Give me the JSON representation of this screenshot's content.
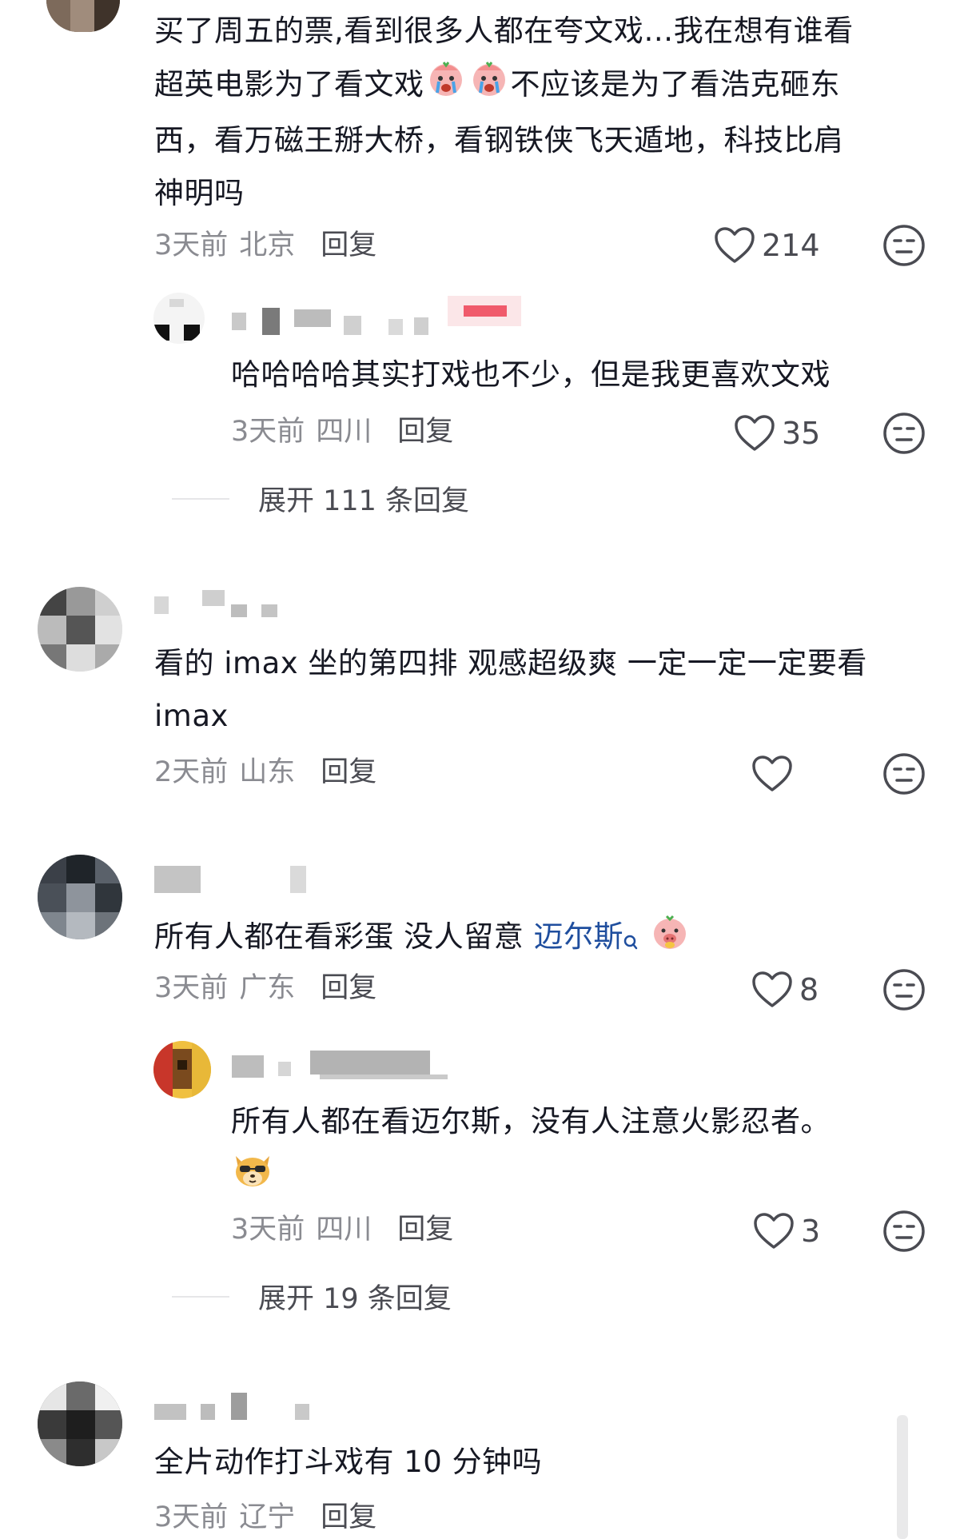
{
  "comments": [
    {
      "text_lines": [
        "买了周五的票,看到很多人都在夸文戏…我在想有谁看",
        "超英电影为了看文戏",
        "不应该是为了看浩克砸东",
        "西，看万磁王掰大桥，看钢铁侠飞天遁地，科技比肩",
        "神明吗"
      ],
      "time": "3天前",
      "location": "北京",
      "reply_label": "回复",
      "likes": "214",
      "emoji_icon": "crying-face-sticker-icon"
    },
    {
      "text": "哈哈哈哈其实打戏也不少，但是我更喜欢文戏",
      "time": "3天前",
      "location": "四川",
      "reply_label": "回复",
      "likes": "35"
    },
    {
      "expand_label": "展开 111 条回复"
    },
    {
      "text_lines": [
        "看的 imax 坐的第四排 观感超级爽  一定一定一定要看",
        "imax"
      ],
      "time": "2天前",
      "location": "山东",
      "reply_label": "回复",
      "likes": ""
    },
    {
      "text": "所有人都在看彩蛋 没人留意 ",
      "mention": "迈尔斯",
      "mention_icon": "search-icon",
      "time": "3天前",
      "location": "广东",
      "reply_label": "回复",
      "likes": "8"
    },
    {
      "text": "所有人都在看迈尔斯，没有人注意火影忍者。",
      "time": "3天前",
      "location": "四川",
      "reply_label": "回复",
      "likes": "3",
      "emoji_icon": "dog-sunglasses-sticker-icon"
    },
    {
      "expand_label": "展开 19 条回复"
    },
    {
      "text": "全片动作打斗戏有 10 分钟吗",
      "time": "3天前",
      "location": "辽宁",
      "reply_label": "回复"
    }
  ],
  "colors": {
    "text": "#161823",
    "meta": "#8a8b91",
    "reply": "#4a4b52",
    "mention": "#1f4e9e"
  }
}
